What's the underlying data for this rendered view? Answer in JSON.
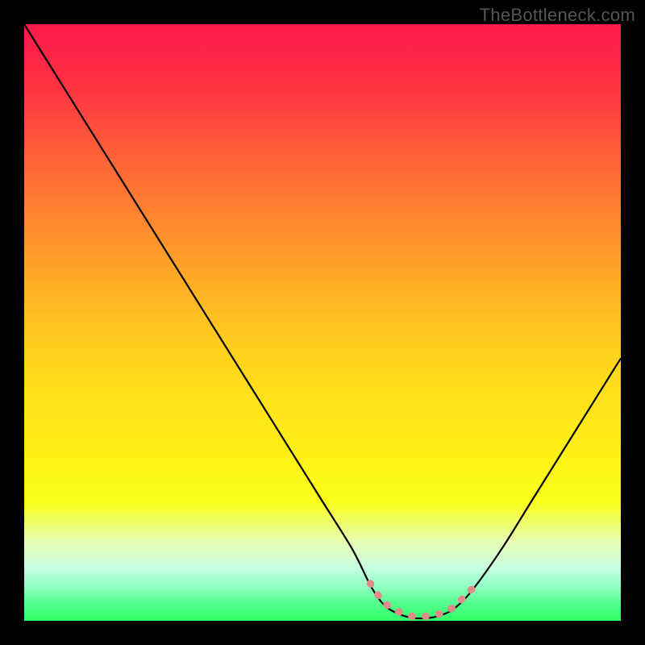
{
  "watermark": "TheBottleneck.com",
  "chart_data": {
    "type": "line",
    "title": "",
    "xlabel": "",
    "ylabel": "",
    "xlim": [
      0,
      100
    ],
    "ylim": [
      0,
      100
    ],
    "grid": false,
    "legend": false,
    "x": [
      0,
      5,
      10,
      15,
      20,
      25,
      30,
      35,
      40,
      45,
      50,
      55,
      58,
      60,
      62,
      65,
      68,
      70,
      72,
      75,
      80,
      85,
      90,
      95,
      100
    ],
    "values": [
      100,
      92,
      84,
      76,
      68,
      60,
      52,
      44,
      36,
      28,
      20,
      12,
      6,
      3,
      1.5,
      0.5,
      0.5,
      1,
      2,
      5,
      12,
      20,
      28,
      36,
      44
    ],
    "threshold_region": {
      "x_start": 58,
      "x_end": 75,
      "y_approx": 3
    },
    "colors": {
      "gradient_top": "#ff1a4d",
      "gradient_mid": "#ffe519",
      "gradient_bottom": "#2eff66",
      "curve": "#000000",
      "threshold_marker": "#e08a8a",
      "background": "#000000"
    }
  }
}
